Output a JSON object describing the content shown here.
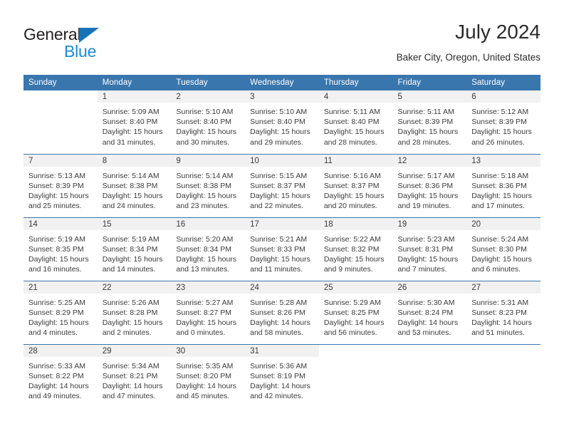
{
  "brand": {
    "word_general": "General",
    "word_blue": "Blue"
  },
  "header": {
    "title": "July 2024",
    "subtitle": "Baker City, Oregon, United States"
  },
  "calendar": {
    "weekdays": [
      "Sunday",
      "Monday",
      "Tuesday",
      "Wednesday",
      "Thursday",
      "Friday",
      "Saturday"
    ],
    "accent_color": "#3a76ae",
    "daynum_band_color": "#f1f1f1",
    "weeks": [
      [
        {
          "day": "",
          "lines": []
        },
        {
          "day": "1",
          "lines": [
            "Sunrise: 5:09 AM",
            "Sunset: 8:40 PM",
            "Daylight: 15 hours",
            "and 31 minutes."
          ]
        },
        {
          "day": "2",
          "lines": [
            "Sunrise: 5:10 AM",
            "Sunset: 8:40 PM",
            "Daylight: 15 hours",
            "and 30 minutes."
          ]
        },
        {
          "day": "3",
          "lines": [
            "Sunrise: 5:10 AM",
            "Sunset: 8:40 PM",
            "Daylight: 15 hours",
            "and 29 minutes."
          ]
        },
        {
          "day": "4",
          "lines": [
            "Sunrise: 5:11 AM",
            "Sunset: 8:40 PM",
            "Daylight: 15 hours",
            "and 28 minutes."
          ]
        },
        {
          "day": "5",
          "lines": [
            "Sunrise: 5:11 AM",
            "Sunset: 8:39 PM",
            "Daylight: 15 hours",
            "and 28 minutes."
          ]
        },
        {
          "day": "6",
          "lines": [
            "Sunrise: 5:12 AM",
            "Sunset: 8:39 PM",
            "Daylight: 15 hours",
            "and 26 minutes."
          ]
        }
      ],
      [
        {
          "day": "7",
          "lines": [
            "Sunrise: 5:13 AM",
            "Sunset: 8:39 PM",
            "Daylight: 15 hours",
            "and 25 minutes."
          ]
        },
        {
          "day": "8",
          "lines": [
            "Sunrise: 5:14 AM",
            "Sunset: 8:38 PM",
            "Daylight: 15 hours",
            "and 24 minutes."
          ]
        },
        {
          "day": "9",
          "lines": [
            "Sunrise: 5:14 AM",
            "Sunset: 8:38 PM",
            "Daylight: 15 hours",
            "and 23 minutes."
          ]
        },
        {
          "day": "10",
          "lines": [
            "Sunrise: 5:15 AM",
            "Sunset: 8:37 PM",
            "Daylight: 15 hours",
            "and 22 minutes."
          ]
        },
        {
          "day": "11",
          "lines": [
            "Sunrise: 5:16 AM",
            "Sunset: 8:37 PM",
            "Daylight: 15 hours",
            "and 20 minutes."
          ]
        },
        {
          "day": "12",
          "lines": [
            "Sunrise: 5:17 AM",
            "Sunset: 8:36 PM",
            "Daylight: 15 hours",
            "and 19 minutes."
          ]
        },
        {
          "day": "13",
          "lines": [
            "Sunrise: 5:18 AM",
            "Sunset: 8:36 PM",
            "Daylight: 15 hours",
            "and 17 minutes."
          ]
        }
      ],
      [
        {
          "day": "14",
          "lines": [
            "Sunrise: 5:19 AM",
            "Sunset: 8:35 PM",
            "Daylight: 15 hours",
            "and 16 minutes."
          ]
        },
        {
          "day": "15",
          "lines": [
            "Sunrise: 5:19 AM",
            "Sunset: 8:34 PM",
            "Daylight: 15 hours",
            "and 14 minutes."
          ]
        },
        {
          "day": "16",
          "lines": [
            "Sunrise: 5:20 AM",
            "Sunset: 8:34 PM",
            "Daylight: 15 hours",
            "and 13 minutes."
          ]
        },
        {
          "day": "17",
          "lines": [
            "Sunrise: 5:21 AM",
            "Sunset: 8:33 PM",
            "Daylight: 15 hours",
            "and 11 minutes."
          ]
        },
        {
          "day": "18",
          "lines": [
            "Sunrise: 5:22 AM",
            "Sunset: 8:32 PM",
            "Daylight: 15 hours",
            "and 9 minutes."
          ]
        },
        {
          "day": "19",
          "lines": [
            "Sunrise: 5:23 AM",
            "Sunset: 8:31 PM",
            "Daylight: 15 hours",
            "and 7 minutes."
          ]
        },
        {
          "day": "20",
          "lines": [
            "Sunrise: 5:24 AM",
            "Sunset: 8:30 PM",
            "Daylight: 15 hours",
            "and 6 minutes."
          ]
        }
      ],
      [
        {
          "day": "21",
          "lines": [
            "Sunrise: 5:25 AM",
            "Sunset: 8:29 PM",
            "Daylight: 15 hours",
            "and 4 minutes."
          ]
        },
        {
          "day": "22",
          "lines": [
            "Sunrise: 5:26 AM",
            "Sunset: 8:28 PM",
            "Daylight: 15 hours",
            "and 2 minutes."
          ]
        },
        {
          "day": "23",
          "lines": [
            "Sunrise: 5:27 AM",
            "Sunset: 8:27 PM",
            "Daylight: 15 hours",
            "and 0 minutes."
          ]
        },
        {
          "day": "24",
          "lines": [
            "Sunrise: 5:28 AM",
            "Sunset: 8:26 PM",
            "Daylight: 14 hours",
            "and 58 minutes."
          ]
        },
        {
          "day": "25",
          "lines": [
            "Sunrise: 5:29 AM",
            "Sunset: 8:25 PM",
            "Daylight: 14 hours",
            "and 56 minutes."
          ]
        },
        {
          "day": "26",
          "lines": [
            "Sunrise: 5:30 AM",
            "Sunset: 8:24 PM",
            "Daylight: 14 hours",
            "and 53 minutes."
          ]
        },
        {
          "day": "27",
          "lines": [
            "Sunrise: 5:31 AM",
            "Sunset: 8:23 PM",
            "Daylight: 14 hours",
            "and 51 minutes."
          ]
        }
      ],
      [
        {
          "day": "28",
          "lines": [
            "Sunrise: 5:33 AM",
            "Sunset: 8:22 PM",
            "Daylight: 14 hours",
            "and 49 minutes."
          ]
        },
        {
          "day": "29",
          "lines": [
            "Sunrise: 5:34 AM",
            "Sunset: 8:21 PM",
            "Daylight: 14 hours",
            "and 47 minutes."
          ]
        },
        {
          "day": "30",
          "lines": [
            "Sunrise: 5:35 AM",
            "Sunset: 8:20 PM",
            "Daylight: 14 hours",
            "and 45 minutes."
          ]
        },
        {
          "day": "31",
          "lines": [
            "Sunrise: 5:36 AM",
            "Sunset: 8:19 PM",
            "Daylight: 14 hours",
            "and 42 minutes."
          ]
        },
        {
          "day": "",
          "lines": []
        },
        {
          "day": "",
          "lines": []
        },
        {
          "day": "",
          "lines": []
        }
      ]
    ]
  }
}
